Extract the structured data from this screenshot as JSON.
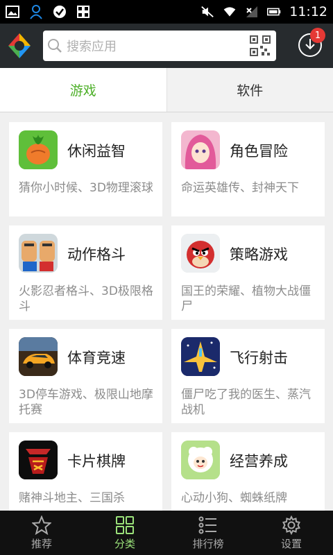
{
  "status_bar": {
    "time": "11:12"
  },
  "search": {
    "placeholder": "搜索应用"
  },
  "download_badge": "1",
  "tabs": [
    {
      "label": "游戏"
    },
    {
      "label": "软件"
    }
  ],
  "categories": [
    {
      "title": "休闲益智",
      "desc": "猜你小时候、3D物理滚球"
    },
    {
      "title": "角色冒险",
      "desc": "命运英雄传、封神天下"
    },
    {
      "title": "动作格斗",
      "desc": "火影忍者格斗、3D极限格斗"
    },
    {
      "title": "策略游戏",
      "desc": "国王的荣耀、植物大战僵尸"
    },
    {
      "title": "体育竞速",
      "desc": "3D停车游戏、极限山地摩托赛"
    },
    {
      "title": "飞行射击",
      "desc": "僵尸吃了我的医生、蒸汽战机"
    },
    {
      "title": "卡片棋牌",
      "desc": "赌神斗地主、三国杀"
    },
    {
      "title": "经营养成",
      "desc": "心动小狗、蜘蛛纸牌"
    }
  ],
  "bottom_nav": [
    {
      "label": "推荐"
    },
    {
      "label": "分类"
    },
    {
      "label": "排行榜"
    },
    {
      "label": "设置"
    }
  ],
  "colors": {
    "accent": "#4caf27",
    "topbar": "#272b2e",
    "badge": "#e53935"
  }
}
